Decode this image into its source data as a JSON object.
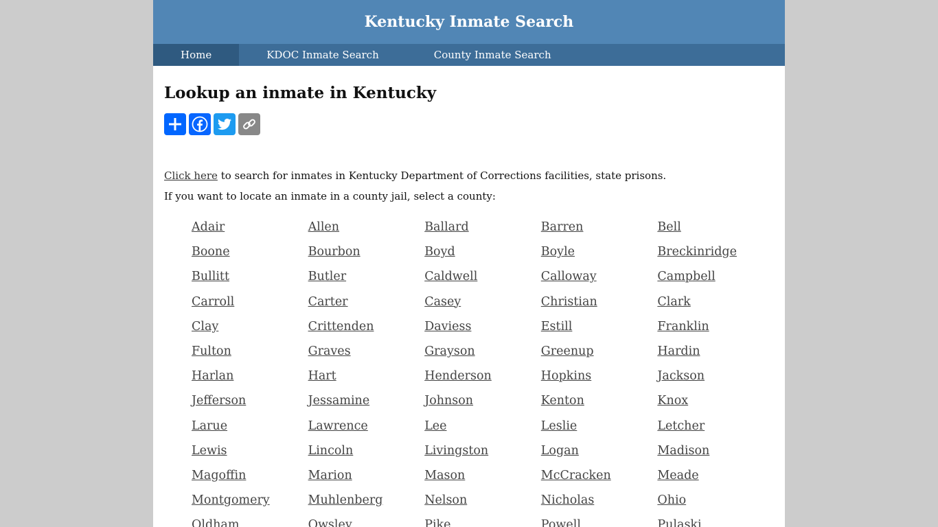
{
  "header": {
    "title": "Kentucky Inmate Search"
  },
  "nav": {
    "items": [
      {
        "label": "Home"
      },
      {
        "label": "KDOC Inmate Search"
      },
      {
        "label": "County Inmate Search"
      }
    ]
  },
  "main": {
    "heading": "Lookup an inmate in Kentucky",
    "share": [
      {
        "icon": "share-plus-icon",
        "color": "#0166ff"
      },
      {
        "icon": "facebook-icon",
        "color": "#0866ff"
      },
      {
        "icon": "twitter-icon",
        "color": "#1d9bf0"
      },
      {
        "icon": "copy-link-icon",
        "color": "#888888"
      }
    ],
    "kdoc_link": "Click here",
    "kdoc_text": " to search for inmates in Kentucky Department of Corrections facilities, state prisons.",
    "county_prompt": "If you want to locate an inmate in a county jail, select a county:"
  },
  "counties": [
    "Adair",
    "Allen",
    "Ballard",
    "Barren",
    "Bell",
    "Boone",
    "Bourbon",
    "Boyd",
    "Boyle",
    "Breckinridge",
    "Bullitt",
    "Butler",
    "Caldwell",
    "Calloway",
    "Campbell",
    "Carroll",
    "Carter",
    "Casey",
    "Christian",
    "Clark",
    "Clay",
    "Crittenden",
    "Daviess",
    "Estill",
    "Franklin",
    "Fulton",
    "Graves",
    "Grayson",
    "Greenup",
    "Hardin",
    "Harlan",
    "Hart",
    "Henderson",
    "Hopkins",
    "Jackson",
    "Jefferson",
    "Jessamine",
    "Johnson",
    "Kenton",
    "Knox",
    "Larue",
    "Lawrence",
    "Lee",
    "Leslie",
    "Letcher",
    "Lewis",
    "Lincoln",
    "Livingston",
    "Logan",
    "Madison",
    "Magoffin",
    "Marion",
    "Mason",
    "McCracken",
    "Meade",
    "Montgomery",
    "Muhlenberg",
    "Nelson",
    "Nicholas",
    "Ohio",
    "Oldham",
    "Owsley",
    "Pike",
    "Powell",
    "Pulaski"
  ]
}
